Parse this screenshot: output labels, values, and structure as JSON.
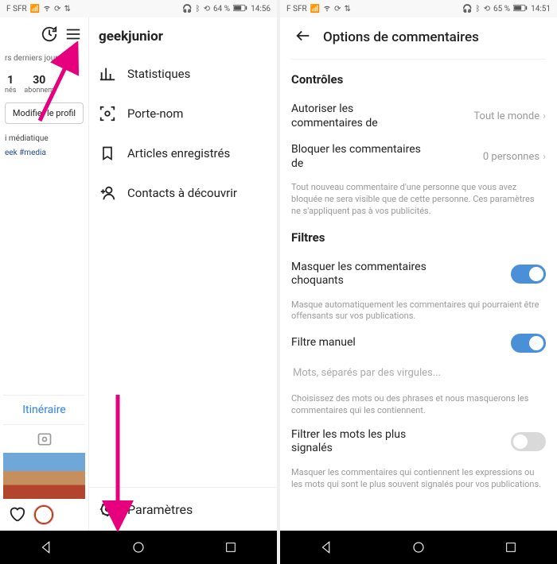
{
  "left": {
    "status": {
      "carrier": "F SFR",
      "battery": "64 %",
      "time": "14:56"
    },
    "profile": {
      "username": "geekjunior",
      "timeframe": "rs derniers jours",
      "stat1_num": "1",
      "stat1_lbl": "nés",
      "stat2_num": "30",
      "stat2_lbl": "abonnem",
      "edit_btn": "Modifier le profil",
      "bio_line": "i médiatique",
      "hash_line": "eek #media",
      "itineraire": "Itinéraire"
    },
    "menu": {
      "items": [
        {
          "label": "Statistiques"
        },
        {
          "label": "Porte-nom"
        },
        {
          "label": "Articles enregistrés"
        },
        {
          "label": "Contacts à découvrir"
        }
      ],
      "settings": "Paramètres"
    }
  },
  "right": {
    "status": {
      "carrier": "F SFR",
      "battery": "65 %",
      "time": "14:51"
    },
    "title": "Options de commentaires",
    "controls": {
      "heading": "Contrôles",
      "allow_lbl": "Autoriser les commentaires de",
      "allow_val": "Tout le monde",
      "block_lbl": "Bloquer les commentaires de",
      "block_val": "0 personnes",
      "helper": "Tout nouveau commentaire d'une personne que vous avez bloquée ne sera visible que de cette personne. Ces paramètres ne s'appliquent pas à vos publicités."
    },
    "filters": {
      "heading": "Filtres",
      "offensive_lbl": "Masquer les commentaires choquants",
      "offensive_help": "Masque automatiquement les commentaires qui pourraient être offensants sur vos publications.",
      "manual_lbl": "Filtre manuel",
      "manual_placeholder": "Mots, séparés par des virgules...",
      "manual_help": "Choisissez des mots ou des phrases et nous masquerons les commentaires qui les contiennent.",
      "reported_lbl": "Filtrer les mots les plus signalés",
      "reported_help": "Masquer les commentaires qui contiennent les expressions ou les mots qui sont le plus souvent signalés pour vos publications."
    }
  }
}
